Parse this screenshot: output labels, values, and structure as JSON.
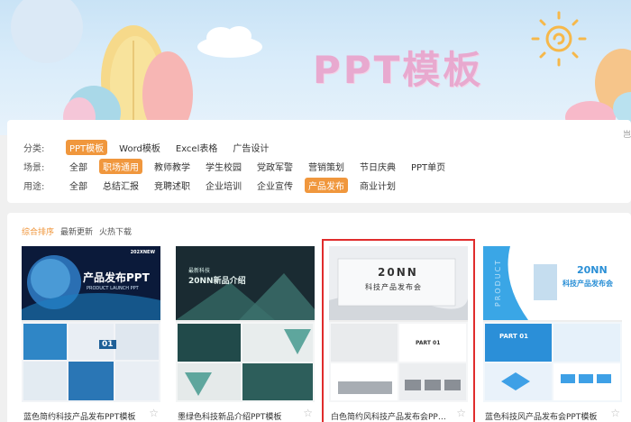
{
  "banner": {
    "title": "PPT模板"
  },
  "filters": {
    "side_glyph": "岂",
    "rows": [
      {
        "label": "分类:",
        "options": [
          "PPT模板",
          "Word模板",
          "Excel表格",
          "广告设计"
        ],
        "active": 0
      },
      {
        "label": "场景:",
        "options": [
          "全部",
          "职场通用",
          "教师教学",
          "学生校园",
          "党政军警",
          "营销策划",
          "节日庆典",
          "PPT单页"
        ],
        "active": 1
      },
      {
        "label": "用途:",
        "options": [
          "全部",
          "总结汇报",
          "竞聘述职",
          "企业培训",
          "企业宣传",
          "产品发布",
          "商业计划"
        ],
        "active": 5
      }
    ]
  },
  "sort": {
    "items": [
      "综合排序",
      "最新更新",
      "火热下载"
    ],
    "active": 0
  },
  "cards": [
    {
      "caption": "蓝色简约科技产品发布PPT模板",
      "thumb_title": "产品发布PPT",
      "thumb_sub": "PRODUCT LAUNCH PPT",
      "thumb_year": "202XNEW",
      "part": "01"
    },
    {
      "caption": "墨绿色科技新品介绍PPT模板",
      "thumb_title": "20NN新品介绍",
      "thumb_sub": "最新科技"
    },
    {
      "caption": "白色简约风科技产品发布会PPT...",
      "thumb_title": "20NN",
      "thumb_sub": "科技产品发布会",
      "part": "PART 01"
    },
    {
      "caption": "蓝色科技风产品发布会PPT模板",
      "thumb_title": "20NN",
      "thumb_sub": "科技产品发布会",
      "side": "PRODUCT",
      "part": "PART 01"
    }
  ],
  "colors": {
    "accent": "#f0973d",
    "selected": "#e02c2c"
  },
  "icons": {
    "star": "star-icon",
    "sun": "sun-icon"
  }
}
